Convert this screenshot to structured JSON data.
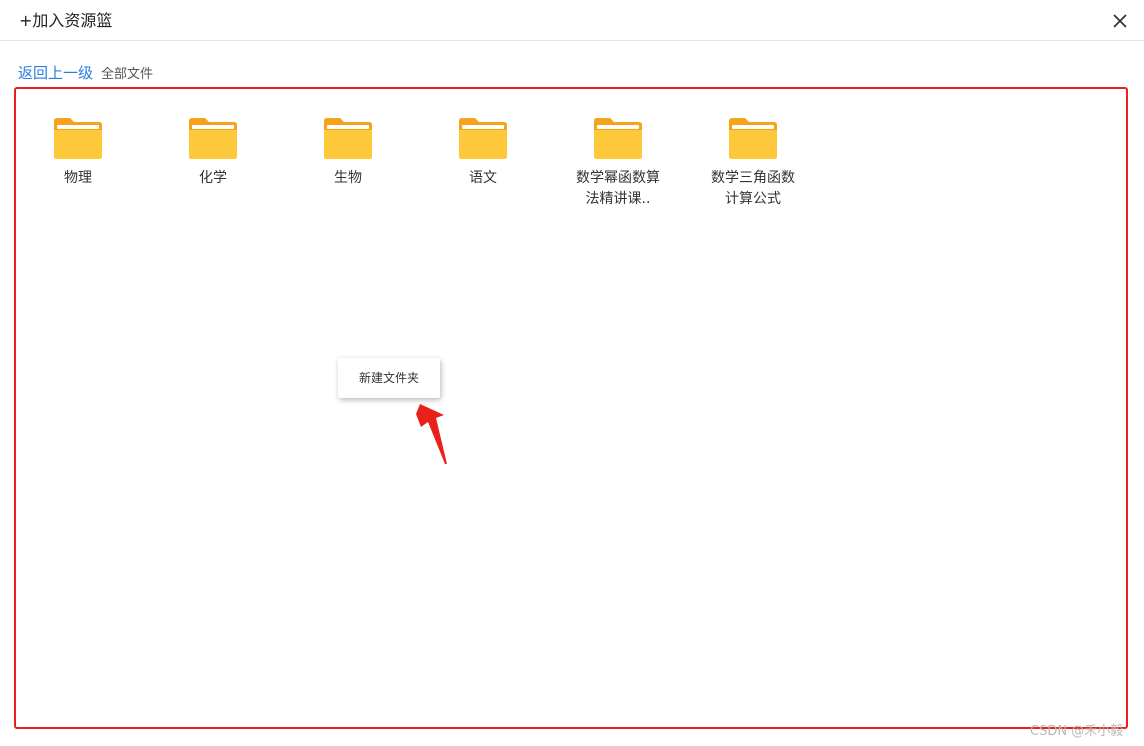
{
  "dialog": {
    "title": "+加入资源篮",
    "close_icon": "close-icon"
  },
  "breadcrumb": {
    "back_label": "返回上一级",
    "current": "全部文件"
  },
  "folders": [
    {
      "name": "物理",
      "icon": "folder-icon"
    },
    {
      "name": "化学",
      "icon": "folder-icon"
    },
    {
      "name": "生物",
      "icon": "folder-icon"
    },
    {
      "name": "语文",
      "icon": "folder-icon"
    },
    {
      "name": "数学幂函数算法精讲课..",
      "icon": "folder-icon"
    },
    {
      "name": "数学三角函数计算公式",
      "icon": "folder-icon"
    }
  ],
  "context_menu": {
    "items": [
      {
        "label": "新建文件夹"
      }
    ]
  },
  "watermark": "CSDN @禾小毅",
  "colors": {
    "link": "#2d7de0",
    "highlight_border": "#e8221b",
    "annotation_arrow": "#e8221b",
    "folder_front": "#fdc83a",
    "folder_back": "#f5a31a",
    "folder_paper": "#ffffff"
  }
}
